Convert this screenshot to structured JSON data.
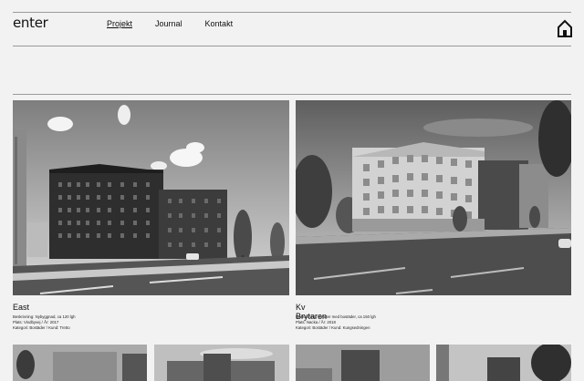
{
  "header": {
    "logo": "enter",
    "nav": [
      {
        "label": "Projekt",
        "active": true
      },
      {
        "label": "Journal",
        "active": false
      },
      {
        "label": "Kontakt",
        "active": false
      }
    ],
    "home_icon": "house-icon"
  },
  "projects": [
    {
      "title": "East",
      "beskrivning": "Beskrivning: Nybyggnad, ca 120 lgh",
      "plats": "Plats: Vindbyvej / År: 2017",
      "kategori": "Kategori: Bostäder / Kund: Tretto"
    },
    {
      "title": "Kv Brytaren",
      "beskrivning": "Beskrivning: Kvarter med bostäder, ca 150 lgh",
      "plats": "Plats: Nacka / År: 2018",
      "kategori": "Kategori: Bostäder / Kund: Kungsedningen"
    }
  ],
  "palette": {
    "background": "#f2f2f2",
    "text": "#111111",
    "rule": "#9a9a9a"
  }
}
